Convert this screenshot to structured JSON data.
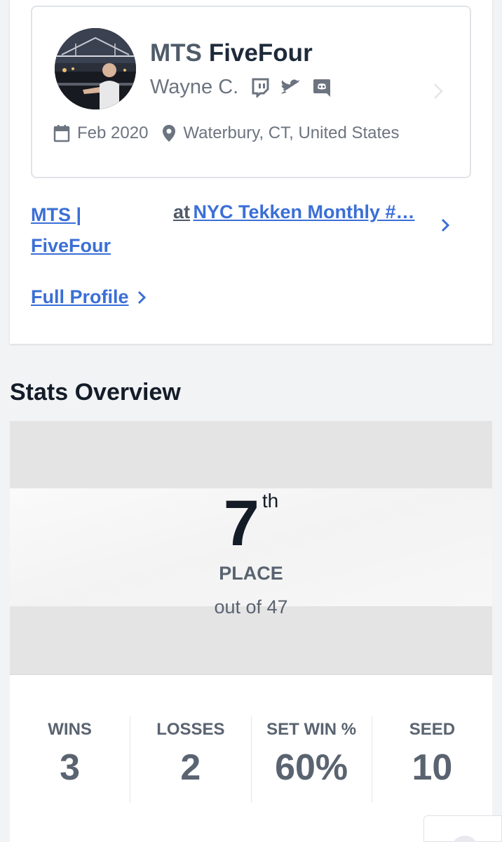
{
  "profile": {
    "prefix": "MTS",
    "gamertag": "FiveFour",
    "real_name": "Wayne C.",
    "social_icons": [
      "twitch-icon",
      "twitter-icon",
      "discord-icon"
    ],
    "joined": "Feb 2020",
    "location": "Waterbury, CT, United States"
  },
  "entrant": {
    "attendee_link": "MTS | FiveFour",
    "at_label": "at",
    "event_link": "NYC Tekken Monthly #…"
  },
  "full_profile_label": "Full Profile",
  "stats_overview": {
    "title": "Stats Overview",
    "placement": "7",
    "placement_suffix": "th",
    "place_label": "PLACE",
    "out_of": "out of 47",
    "stats": [
      {
        "label": "WINS",
        "value": "3"
      },
      {
        "label": "LOSSES",
        "value": "2"
      },
      {
        "label": "SET WIN %",
        "value": "60%"
      },
      {
        "label": "SEED",
        "value": "10"
      }
    ]
  },
  "colors": {
    "link": "#3b6fd6",
    "text_dark": "#1e2a3a",
    "text_muted": "#6c7480",
    "band_gray": "#e4e4e4"
  }
}
